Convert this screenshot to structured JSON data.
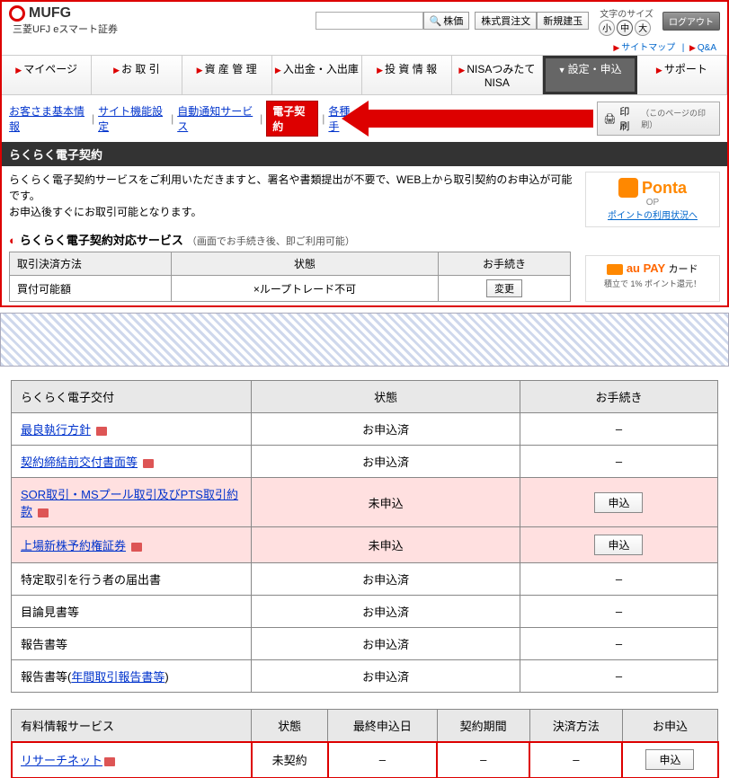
{
  "header": {
    "brand": "MUFG",
    "subbrand": "三菱UFJ eスマート証券",
    "search_btn": "株価",
    "order_btn": "株式買注文",
    "new_btn": "新規建玉",
    "size_label": "文字のサイズ",
    "size_s": "小",
    "size_m": "中",
    "size_l": "大",
    "logout": "ログアウト",
    "sitemap": "サイトマップ",
    "qa": "Q&A"
  },
  "nav": {
    "mypage": "マイページ",
    "trade": "お 取 引",
    "asset": "資 産 管 理",
    "inout": "入出金・入出庫",
    "invest": "投 資 情 報",
    "nisa": "NISAつみたてNISA",
    "settings": "設定・申込",
    "support": "サポート"
  },
  "sublinks": {
    "basic": "お客さま基本情報",
    "site": "サイト機能設定",
    "auto": "自動通知サービス",
    "ec": "電子契約",
    "misc": "各種手"
  },
  "print": {
    "label": "印刷",
    "note": "（このページの印刷）"
  },
  "sec_title": "らくらく電子契約",
  "body1": "らくらく電子契約サービスをご利用いただきますと、署名や書類提出が不要で、WEB上から取引契約のお申込が可能です。",
  "body2": "お申込後すぐにお取引可能となります。",
  "ponta": {
    "name": "Ponta",
    "op": "OP",
    "link": "ポイントの利用状況へ"
  },
  "svc": {
    "title": "らくらく電子契約対応サービス",
    "note": "（画面でお手続き後、即ご利用可能）"
  },
  "t1": {
    "h1": "取引決済方法",
    "h2": "状態",
    "h3": "お手続き",
    "r1c1": "買付可能額",
    "r1c2": "×ループトレード不可",
    "r1btn": "変更"
  },
  "aupay": {
    "brand": "au PAY",
    "card": "カード",
    "line": "積立で 1% ポイント還元！"
  },
  "t2": {
    "h1": "らくらく電子交付",
    "h2": "状態",
    "h3": "お手続き",
    "rows": [
      {
        "label": "最良執行方針",
        "has_pdf": true,
        "link": true,
        "status": "お申込済",
        "action": "–",
        "pink": false
      },
      {
        "label": "契約締結前交付書面等",
        "has_pdf": true,
        "link": true,
        "status": "お申込済",
        "action": "–",
        "pink": false
      },
      {
        "label": "SOR取引・MSプール取引及びPTS取引約款",
        "has_pdf": true,
        "link": true,
        "status": "未申込",
        "action": "申込",
        "pink": true
      },
      {
        "label": "上場新株予約権証券",
        "has_pdf": true,
        "link": true,
        "status": "未申込",
        "action": "申込",
        "pink": true
      },
      {
        "label": "特定取引を行う者の届出書",
        "has_pdf": false,
        "link": false,
        "status": "お申込済",
        "action": "–",
        "pink": false
      },
      {
        "label": "目論見書等",
        "has_pdf": false,
        "link": false,
        "status": "お申込済",
        "action": "–",
        "pink": false
      },
      {
        "label": "報告書等",
        "has_pdf": false,
        "link": false,
        "status": "お申込済",
        "action": "–",
        "pink": false
      },
      {
        "label": "報告書等(年間取引報告書等)",
        "has_pdf": false,
        "link": true,
        "inner_link": "年間取引報告書等",
        "prefix": "報告書等(",
        "suffix": ")",
        "status": "お申込済",
        "action": "–",
        "pink": false
      }
    ]
  },
  "t3": {
    "h1": "有料情報サービス",
    "h2": "状態",
    "h3": "最終申込日",
    "h4": "契約期間",
    "h5": "決済方法",
    "h6": "お申込",
    "r1": {
      "label": "リサーチネット",
      "status": "未契約",
      "last": "–",
      "period": "–",
      "method": "–",
      "action": "申込"
    }
  }
}
